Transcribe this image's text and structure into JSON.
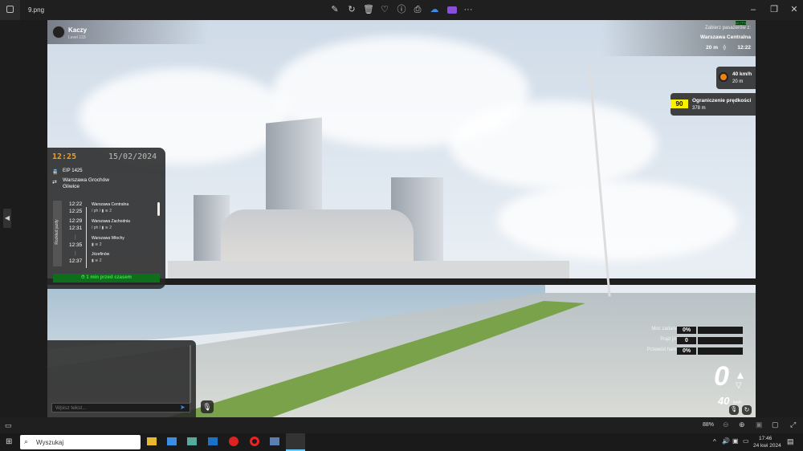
{
  "window": {
    "file_name": "9.png",
    "zoom": "88%"
  },
  "toolbar_icons": [
    "edit-icon",
    "rotate-icon",
    "delete-icon",
    "favorite-icon",
    "info-icon",
    "print-icon",
    "onedrive-icon",
    "clipchamp-icon",
    "more-icon"
  ],
  "player": {
    "name": "Kaczy",
    "level": "Level 133"
  },
  "schedule": {
    "time": "12:25",
    "date": "15/02/2024",
    "train": "EIP 1425",
    "route_from": "Warszawa Grochów",
    "route_to": "Gliwice",
    "tab_label": "Rozkład jazdy",
    "stops": [
      {
        "arr": "12:22",
        "dep": "12:25",
        "name": "Warszawa Centralna",
        "info": "/ ph / ▮ ≋ 2"
      },
      {
        "arr": "12:29",
        "dep": "12:31",
        "name": "Warszawa Zachodnia",
        "info": "/ ph / ▮ ≋ 2"
      },
      {
        "arr": "|",
        "dep": "12:35",
        "name": "Warszawa Włochy",
        "info": "▮ ≋ 2"
      },
      {
        "arr": "|",
        "dep": "12:37",
        "name": "Józefinów",
        "info": "▮ ≋ 2"
      }
    ],
    "status": "1 min przed czasem"
  },
  "chat": {
    "placeholder": "Wpisz tekst..."
  },
  "hud": {
    "fps": "60 FPS",
    "pickup_label": "Zabierz pasażerów z:",
    "pickup_station": "Warszawa Centralna",
    "pickup_distance": "20 m",
    "pickup_time": "12:22",
    "signal_speed": "40 km/h",
    "signal_distance": "20 m",
    "limit_value": "90",
    "limit_label": "Ograniczenie prędkości",
    "limit_distance": "378 m",
    "stats": [
      {
        "label": "Moc zadana",
        "value": "0%",
        "fraction": 0
      },
      {
        "label": "Prąd [A]",
        "value": "0",
        "fraction": 0
      },
      {
        "label": "Przewód ham.",
        "value": "0%",
        "fraction": 0
      }
    ],
    "speed": "0",
    "speed_limit": "40",
    "speed_unit": "km/h"
  },
  "taskbar": {
    "search": "Wyszukaj",
    "time": "17:46",
    "date": "24 kwi 2024"
  }
}
